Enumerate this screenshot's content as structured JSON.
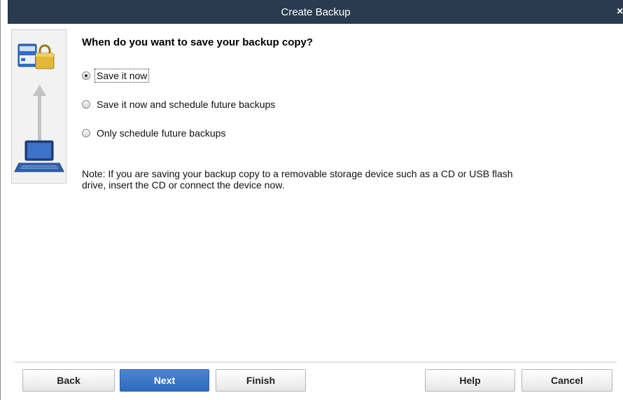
{
  "window": {
    "title": "Create Backup",
    "close_glyph": "×"
  },
  "side_panel": {
    "icons": [
      "storage-icon",
      "lock-icon",
      "up-arrow-icon",
      "laptop-icon"
    ]
  },
  "main": {
    "heading": "When do you want to save your backup copy?",
    "options": [
      {
        "label": "Save it now",
        "selected": true
      },
      {
        "label": "Save it now and schedule future backups",
        "selected": false
      },
      {
        "label": "Only schedule future backups",
        "selected": false
      }
    ],
    "note": "Note: If you are saving your backup copy to a removable storage device such as a CD or USB flash drive, insert the CD or connect the device now."
  },
  "buttons": {
    "back": "Back",
    "next": "Next",
    "finish": "Finish",
    "help": "Help",
    "cancel": "Cancel"
  },
  "colors": {
    "titlebar": "#2a3b4f",
    "primary_button": "#3b77c6"
  }
}
